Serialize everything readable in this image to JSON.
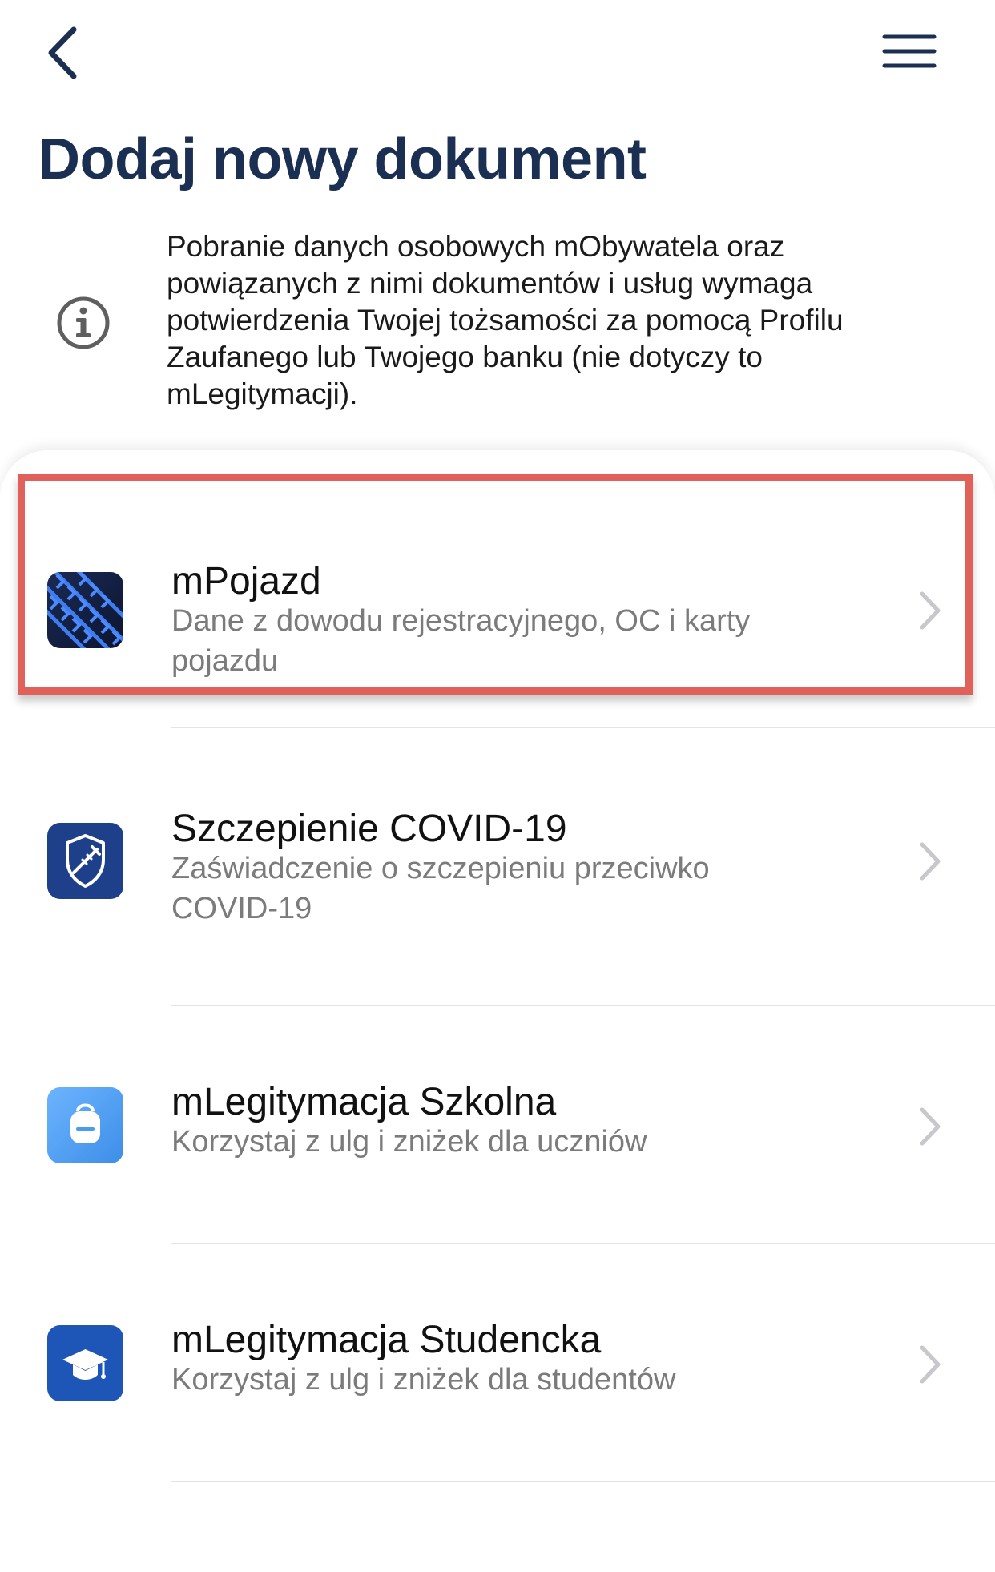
{
  "header": {
    "back_icon": "chevron-left-icon",
    "menu_icon": "hamburger-menu-icon",
    "title": "Dodaj nowy dokument"
  },
  "info": {
    "icon": "info-circle-icon",
    "text": "Pobranie danych osobowych mObywatela oraz powiązanych z nimi dokumentów i usług wymaga potwierdzenia Twojej tożsamości za pomocą Profilu Zaufanego lub Twojego banku (nie dotyczy to mLegitymacji)."
  },
  "documents": [
    {
      "name": "mPojazd",
      "description": "Dane z dowodu rejestracyjnego, OC i karty pojazdu",
      "icon": "mpojazd-tire-icon",
      "highlighted": true
    },
    {
      "name": "Szczepienie COVID-19",
      "description": "Zaświadczenie o szczepieniu przeciwko COVID-19",
      "icon": "vaccine-shield-icon"
    },
    {
      "name": "mLegitymacja Szkolna",
      "description": "Korzystaj z ulg i zniżek dla uczniów",
      "icon": "backpack-icon"
    },
    {
      "name": "mLegitymacja Studencka",
      "description": "Korzystaj z ulg i zniżek dla studentów",
      "icon": "graduation-cap-icon"
    }
  ],
  "colors": {
    "title": "#1b2f52",
    "highlight_border": "#e0605a",
    "description": "#7b7b7b",
    "icon_dark_blue": "#1e3f8a",
    "icon_light_blue": "#4a9cf0"
  }
}
